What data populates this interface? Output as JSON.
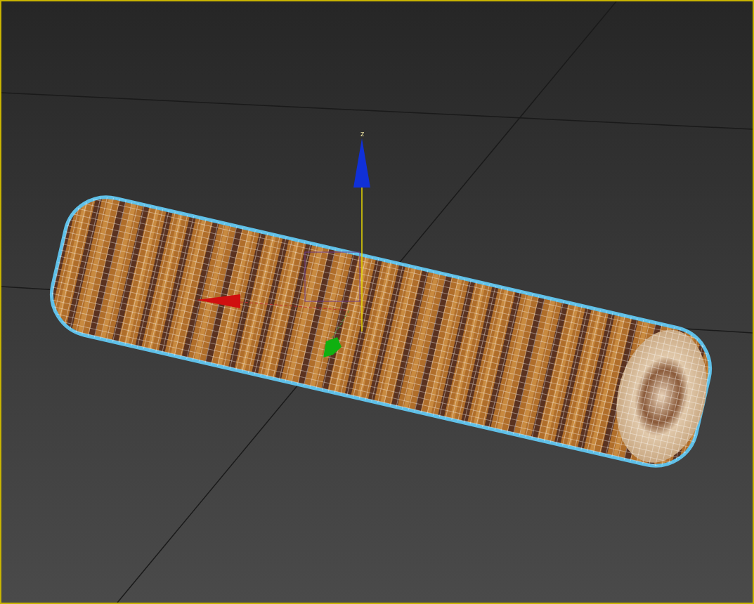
{
  "viewport": {
    "active": true,
    "gizmo": {
      "axis_label": "z"
    }
  }
}
